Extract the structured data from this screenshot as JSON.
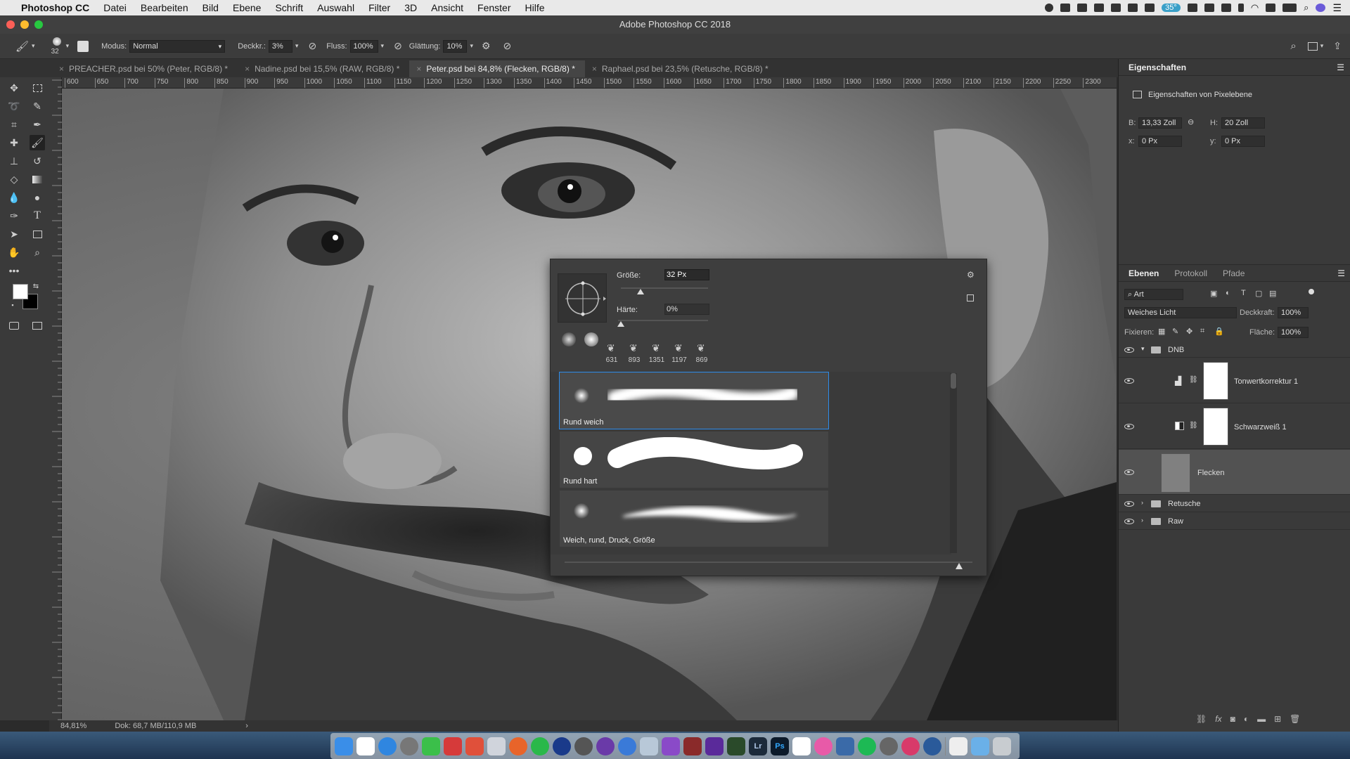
{
  "menubar": {
    "app": "Photoshop CC",
    "items": [
      "Datei",
      "Bearbeiten",
      "Bild",
      "Ebene",
      "Schrift",
      "Auswahl",
      "Filter",
      "3D",
      "Ansicht",
      "Fenster",
      "Hilfe"
    ],
    "battery": "35°"
  },
  "window": {
    "title": "Adobe Photoshop CC 2018"
  },
  "options": {
    "brush_size": "32",
    "mode_label": "Modus:",
    "mode_value": "Normal",
    "opacity_label": "Deckkr.:",
    "opacity_value": "3%",
    "flow_label": "Fluss:",
    "flow_value": "100%",
    "smoothing_label": "Glättung:",
    "smoothing_value": "10%"
  },
  "tabs": [
    {
      "label": "PREACHER.psd bei 50% (Peter, RGB/8) *"
    },
    {
      "label": "Nadine.psd bei 15,5% (RAW, RGB/8) *"
    },
    {
      "label": "Peter.psd bei 84,8% (Flecken, RGB/8) *"
    },
    {
      "label": "Raphael.psd bei 23,5% (Retusche, RGB/8) *"
    }
  ],
  "ruler_ticks": [
    "600",
    "650",
    "700",
    "750",
    "800",
    "850",
    "900",
    "950",
    "1000",
    "1050",
    "1100",
    "1150",
    "1200",
    "1250",
    "1300",
    "1350",
    "1400",
    "1450",
    "1500",
    "1550",
    "1600",
    "1650",
    "1700",
    "1750",
    "1800",
    "1850",
    "1900",
    "1950",
    "2000",
    "2050",
    "2100",
    "2150",
    "2200",
    "2250",
    "2300"
  ],
  "status": {
    "zoom": "84,81%",
    "doc": "Dok: 68,7 MB/110,9 MB",
    "arrow": "›"
  },
  "properties": {
    "title": "Eigenschaften",
    "subtitle": "Eigenschaften von Pixelebene",
    "w_label": "B:",
    "w_value": "13,33 Zoll",
    "h_label": "H:",
    "h_value": "20 Zoll",
    "x_label": "x:",
    "x_value": "0 Px",
    "y_label": "y:",
    "y_value": "0 Px"
  },
  "layers_panel": {
    "tabs": [
      "Ebenen",
      "Protokoll",
      "Pfade"
    ],
    "filter_label": "Art",
    "blend_mode": "Weiches Licht",
    "opacity_label": "Deckkraft:",
    "opacity_value": "100%",
    "lock_label": "Fixieren:",
    "fill_label": "Fläche:",
    "fill_value": "100%",
    "layers": [
      {
        "name": "DNB",
        "type": "group"
      },
      {
        "name": "Tonwertkorrektur 1",
        "type": "adjustment"
      },
      {
        "name": "Schwarzweiß 1",
        "type": "adjustment"
      },
      {
        "name": "Flecken",
        "type": "pixel"
      },
      {
        "name": "Retusche",
        "type": "group"
      },
      {
        "name": "Raw",
        "type": "group"
      }
    ]
  },
  "brush_picker": {
    "size_label": "Größe:",
    "size_value": "32 Px",
    "hardness_label": "Härte:",
    "hardness_value": "0%",
    "size_fraction": 0.06,
    "hardness_fraction": 0.0,
    "presets": [
      "631",
      "893",
      "1351",
      "1197",
      "869"
    ],
    "brushes": [
      {
        "name": "Rund weich",
        "selected": true
      },
      {
        "name": "Rund hart",
        "selected": false
      },
      {
        "name": "Weich, rund, Druck, Größe",
        "selected": false
      }
    ]
  },
  "dock": {
    "lr": "Lr",
    "ps": "Ps"
  }
}
